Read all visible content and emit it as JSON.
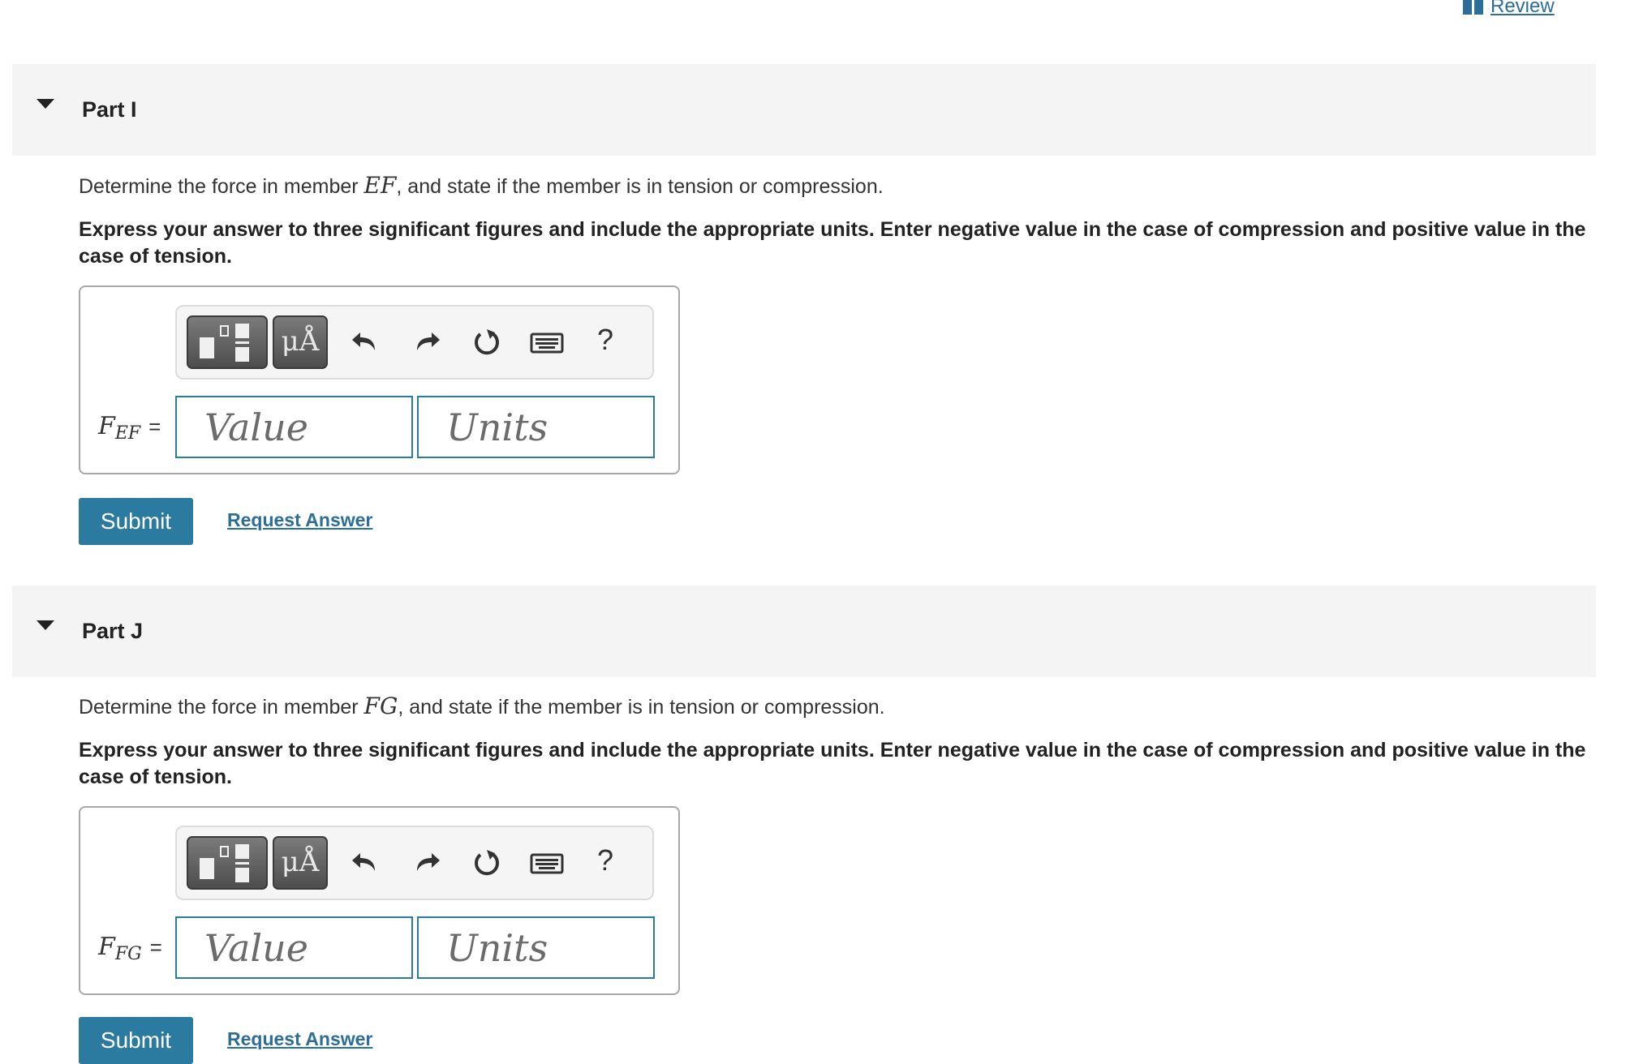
{
  "header": {
    "review_label": "Review"
  },
  "parts": [
    {
      "title": "Part I",
      "question_prefix": "Determine the force in member ",
      "member": "EF",
      "question_suffix": ", and state if the member is in tension or compression.",
      "instructions": "Express your answer to three significant figures and include the appropriate units. Enter negative value in the case of compression and positive value in the case of tension.",
      "variable": "F",
      "variable_sub": "EF",
      "equals": "=",
      "value_placeholder": "Value",
      "units_placeholder": "Units",
      "units_button": "μÅ",
      "help_button": "?",
      "submit_label": "Submit",
      "request_label": "Request Answer"
    },
    {
      "title": "Part J",
      "question_prefix": "Determine the force in member ",
      "member": "FG",
      "question_suffix": ", and state if the member is in tension or compression.",
      "instructions": "Express your answer to three significant figures and include the appropriate units. Enter negative value in the case of compression and positive value in the case of tension.",
      "variable": "F",
      "variable_sub": "FG",
      "equals": "=",
      "value_placeholder": "Value",
      "units_placeholder": "Units",
      "units_button": "μÅ",
      "help_button": "?",
      "submit_label": "Submit",
      "request_label": "Request Answer"
    }
  ],
  "colors": {
    "accent": "#2b7aa0",
    "link": "#2a6e99",
    "header_bg": "#f4f4f4"
  }
}
